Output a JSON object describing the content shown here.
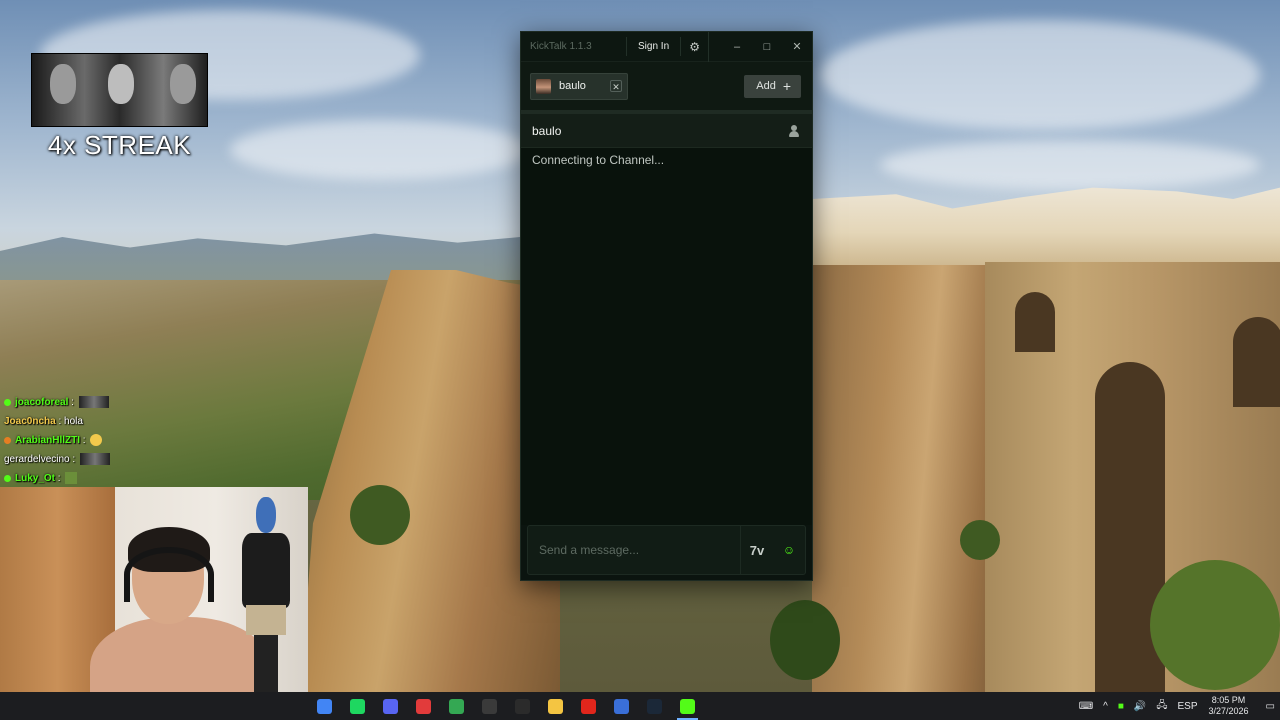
{
  "overlay": {
    "streak_text": "4x STREAK",
    "chat": [
      {
        "user": "joacoforeal",
        "sep": ":",
        "text": "",
        "user_color": "#53fc18",
        "badge_color": "#53fc18",
        "emote": "wide"
      },
      {
        "user": "Joac0ncha",
        "sep": ":",
        "text": "hola",
        "user_color": "#f2c94c",
        "badge_color": "",
        "emote": ""
      },
      {
        "user": "ArabianHllZTI",
        "sep": ":",
        "text": "",
        "user_color": "#53fc18",
        "badge_color": "#e67e22",
        "emote": "round"
      },
      {
        "user": "gerardelvecino",
        "sep": ":",
        "text": "",
        "user_color": "#ffffff",
        "badge_color": "",
        "emote": "wide"
      },
      {
        "user": "Luky_Ot",
        "sep": ":",
        "text": "",
        "user_color": "#53fc18",
        "badge_color": "#53fc18",
        "emote": "can"
      }
    ]
  },
  "kicktalk": {
    "app_title": "KickTalk 1.1.3",
    "signin_label": "Sign In",
    "gear_icon": "gear-icon",
    "window_controls": {
      "minimize": "–",
      "maximize": "□",
      "close": "✕"
    },
    "tab": {
      "label": "baulo",
      "close": "✕"
    },
    "add_label": "Add",
    "add_icon": "+",
    "channel": {
      "name": "baulo",
      "status": "Connecting to Channel..."
    },
    "input": {
      "placeholder": "Send a message...",
      "value": ""
    },
    "input_buttons": {
      "emote_7tv": "7v",
      "emote_kick": "☺"
    },
    "accent_color": "#53fc18"
  },
  "taskbar": {
    "icons": [
      {
        "name": "chrome-partial-icon",
        "color": "#4285f4"
      },
      {
        "name": "spotify-icon",
        "color": "#1ed760"
      },
      {
        "name": "discord-icon",
        "color": "#5865f2"
      },
      {
        "name": "video-editor-icon",
        "color": "#e23b3b"
      },
      {
        "name": "google-chrome-icon",
        "color": "#34a853"
      },
      {
        "name": "obs-icon",
        "color": "#3a3a3a"
      },
      {
        "name": "app-icon",
        "color": "#2b2b2b"
      },
      {
        "name": "folder-icon",
        "color": "#f4c542"
      },
      {
        "name": "opera-icon",
        "color": "#e1261c"
      },
      {
        "name": "network-app-icon",
        "color": "#3a6fd8"
      },
      {
        "name": "steam-icon",
        "color": "#1b2838"
      },
      {
        "name": "kicktalk-icon",
        "color": "#53fc18",
        "active": true
      }
    ],
    "tray": {
      "lang": "ESP",
      "time": "8:05 PM",
      "date": "3/27/2026"
    }
  }
}
